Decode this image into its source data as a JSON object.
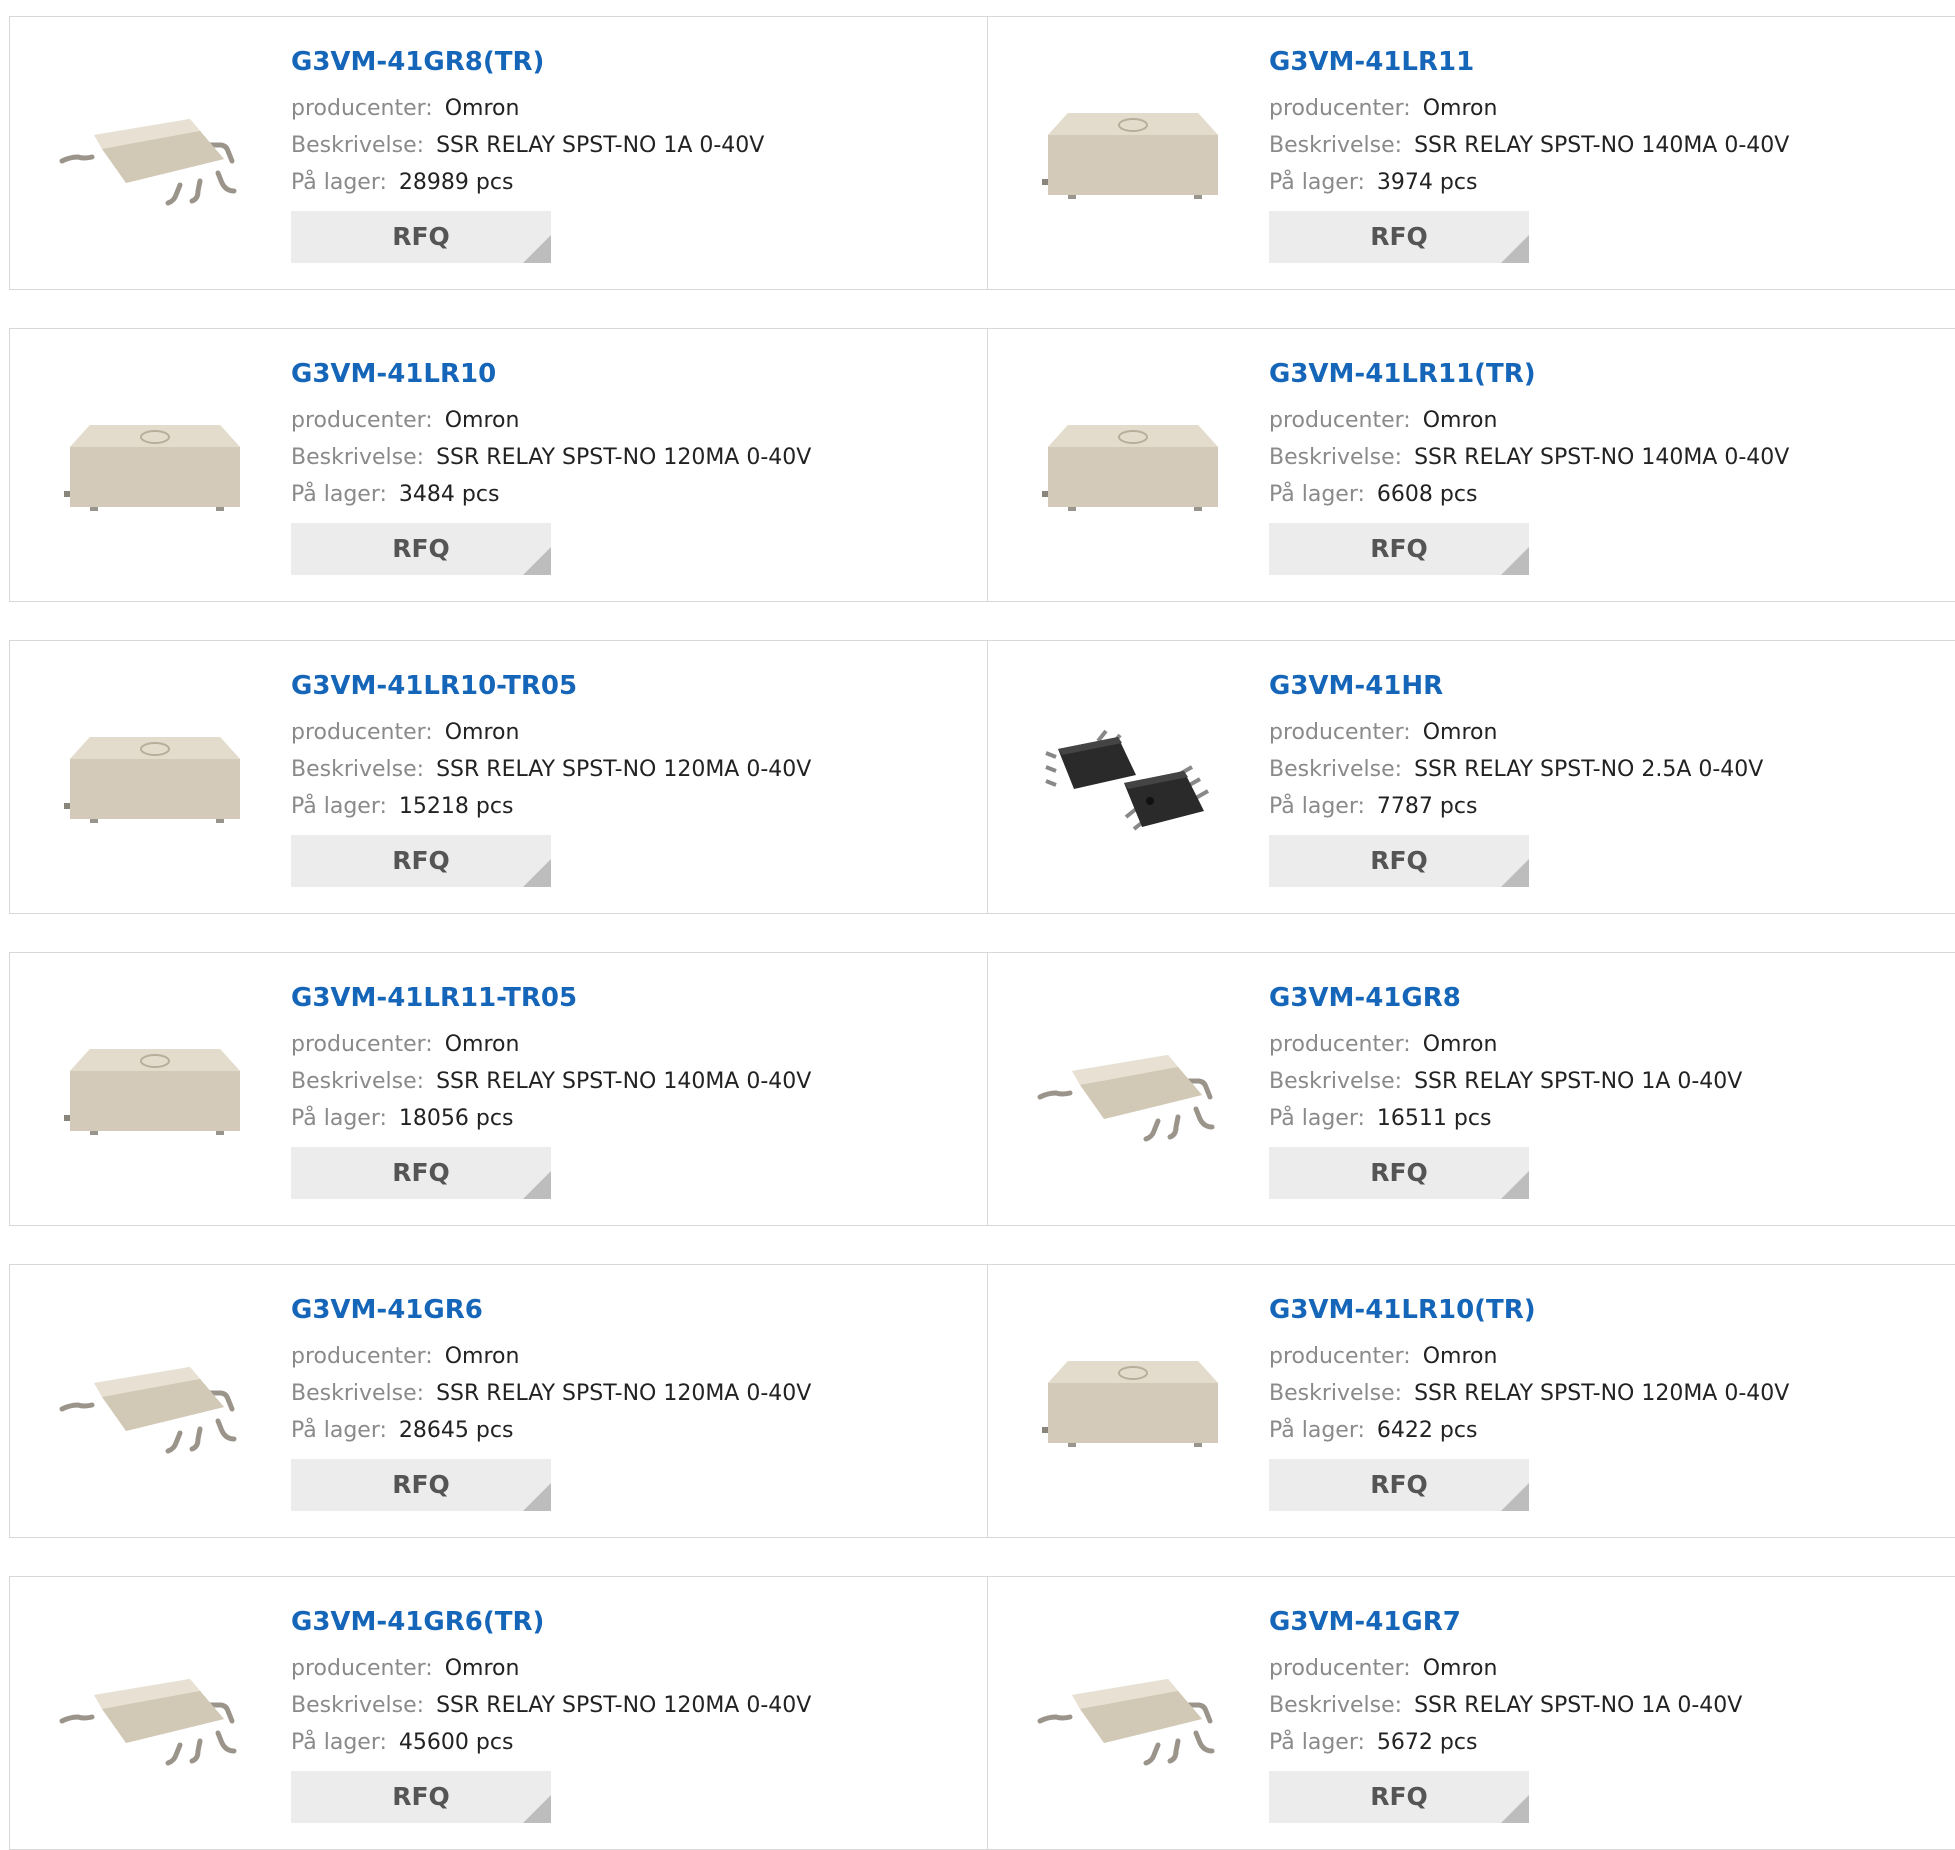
{
  "labels": {
    "manufacturer": "producenter:",
    "description": "Beskrivelse:",
    "stock": "På lager:",
    "rfq": "RFQ"
  },
  "colors": {
    "link": "#1565b8",
    "label": "#8a8a8a",
    "rfq_bg": "#ececec",
    "package_beige": "#d9d0c1",
    "package_black": "#2a2a2a"
  },
  "products": [
    {
      "name": "G3VM-41GR8(TR)",
      "manufacturer": "Omron",
      "description": "SSR RELAY SPST-NO 1A 0-40V",
      "stock": "28989 pcs",
      "image": "sop-gullwing-package"
    },
    {
      "name": "G3VM-41LR11",
      "manufacturer": "Omron",
      "description": "SSR RELAY SPST-NO 140MA 0-40V",
      "stock": "3974 pcs",
      "image": "ssop-beige-package"
    },
    {
      "name": "G3VM-41LR10",
      "manufacturer": "Omron",
      "description": "SSR RELAY SPST-NO 120MA 0-40V",
      "stock": "3484 pcs",
      "image": "ssop-beige-package"
    },
    {
      "name": "G3VM-41LR11(TR)",
      "manufacturer": "Omron",
      "description": "SSR RELAY SPST-NO 140MA 0-40V",
      "stock": "6608 pcs",
      "image": "ssop-beige-package"
    },
    {
      "name": "G3VM-41LR10-TR05",
      "manufacturer": "Omron",
      "description": "SSR RELAY SPST-NO 120MA 0-40V",
      "stock": "15218 pcs",
      "image": "ssop-beige-package"
    },
    {
      "name": "G3VM-41HR",
      "manufacturer": "Omron",
      "description": "SSR RELAY SPST-NO 2.5A 0-40V",
      "stock": "7787 pcs",
      "image": "black-sop-pair"
    },
    {
      "name": "G3VM-41LR11-TR05",
      "manufacturer": "Omron",
      "description": "SSR RELAY SPST-NO 140MA 0-40V",
      "stock": "18056 pcs",
      "image": "ssop-beige-package"
    },
    {
      "name": "G3VM-41GR8",
      "manufacturer": "Omron",
      "description": "SSR RELAY SPST-NO 1A 0-40V",
      "stock": "16511 pcs",
      "image": "sop-gullwing-package"
    },
    {
      "name": "G3VM-41GR6",
      "manufacturer": "Omron",
      "description": "SSR RELAY SPST-NO 120MA 0-40V",
      "stock": "28645 pcs",
      "image": "sop-gullwing-package"
    },
    {
      "name": "G3VM-41LR10(TR)",
      "manufacturer": "Omron",
      "description": "SSR RELAY SPST-NO 120MA 0-40V",
      "stock": "6422 pcs",
      "image": "ssop-beige-package"
    },
    {
      "name": "G3VM-41GR6(TR)",
      "manufacturer": "Omron",
      "description": "SSR RELAY SPST-NO 120MA 0-40V",
      "stock": "45600 pcs",
      "image": "sop-gullwing-package"
    },
    {
      "name": "G3VM-41GR7",
      "manufacturer": "Omron",
      "description": "SSR RELAY SPST-NO 1A 0-40V",
      "stock": "5672 pcs",
      "image": "sop-gullwing-package"
    }
  ]
}
